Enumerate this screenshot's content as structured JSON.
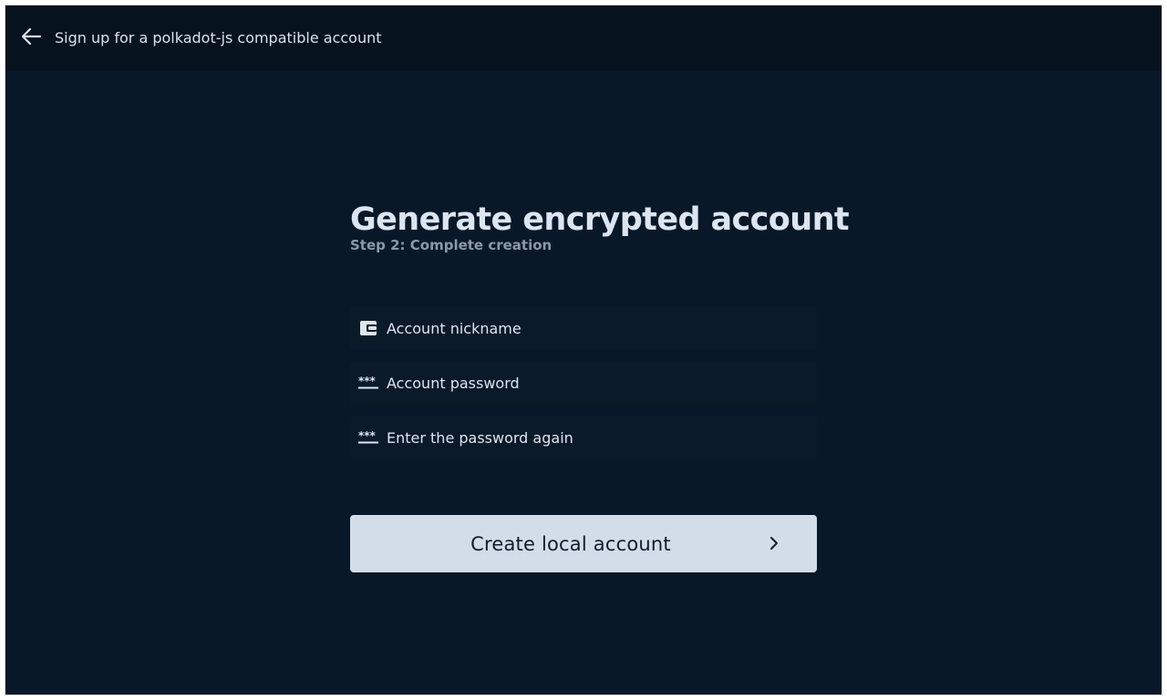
{
  "header": {
    "back_icon": "arrow-left-icon",
    "title": "Sign up for a polkadot-js compatible account"
  },
  "main": {
    "title": "Generate encrypted account",
    "subtitle": "Step 2: Complete creation"
  },
  "form": {
    "fields": [
      {
        "icon": "wallet-icon",
        "placeholder": "Account nickname",
        "value": ""
      },
      {
        "icon": "password-icon",
        "placeholder": "Account password",
        "value": ""
      },
      {
        "icon": "password-icon",
        "placeholder": "Enter the password again",
        "value": ""
      }
    ],
    "submit": {
      "label": "Create local account",
      "icon": "chevron-right-icon"
    }
  },
  "colors": {
    "background": "#081828",
    "topbar": "#06121e",
    "field_background": "#0b1a29",
    "text": "#dce5f0",
    "subtitle": "#8b98a8",
    "button_background": "#d3dde9",
    "button_text": "#0e1c2c"
  }
}
